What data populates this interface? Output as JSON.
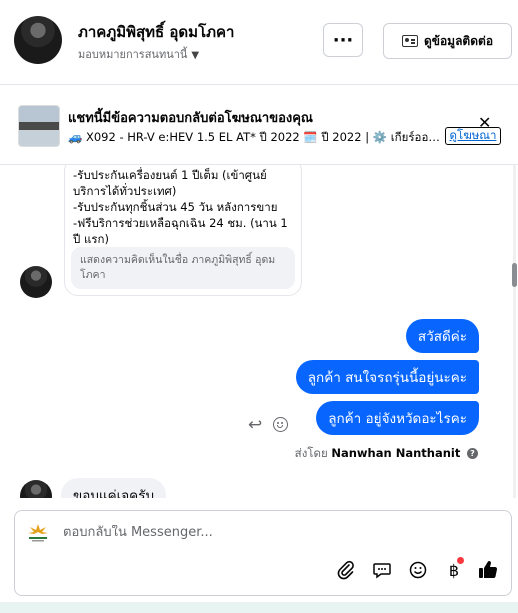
{
  "header": {
    "page_name": "ภาคภูมิพิสุทธิ์ อุดมโภคา",
    "assigned_to": "มอบหมายการสนทนานี้",
    "more_label": "···",
    "contact_label": "ดูข้อมูลติดต่อ"
  },
  "ad": {
    "title": "แชทนี้มีข้อความตอบกลับต่อโฆษณาของคุณ",
    "description": "🚙 X092 - HR-V e:HEV 1.5 EL AT* ปี 2022 🗓️ ปี 2022 | ⚙️ เกียร์ออโต้",
    "link_label": "ดูโฆษณา"
  },
  "messages": {
    "incoming_lines": [
      "-รับประกันเครื่องยนต์ 1 ปีเต็ม (เข้าศูนย์บริการได้ทั่วประเทศ)",
      "-รับประกันทุกชิ้นส่วน 45 วัน หลังการขาย",
      "-ฟรีบริการช่วยเหลือฉุกเฉิน 24 ชม. (นาน 1 ปี แรก)"
    ],
    "reply_note": "แสดงความคิดเห็นในชื่อ ภาคภูมิพิสุทธิ์ อุดมโภคา",
    "outgoing": [
      "สวัสดีค่ะ",
      "ลูกค้า สนใจรถรุ่นนี้อยู่นะคะ",
      "ลูกค้า อยู่จังหวัดอะไรคะ"
    ],
    "sent_by_prefix": "ส่งโดย",
    "sent_by_name": "Nanwhan Nanthanit",
    "partial_reply": "ขอบแค่เจครับ"
  },
  "composer": {
    "placeholder": "ตอบกลับใน Messenger..."
  }
}
